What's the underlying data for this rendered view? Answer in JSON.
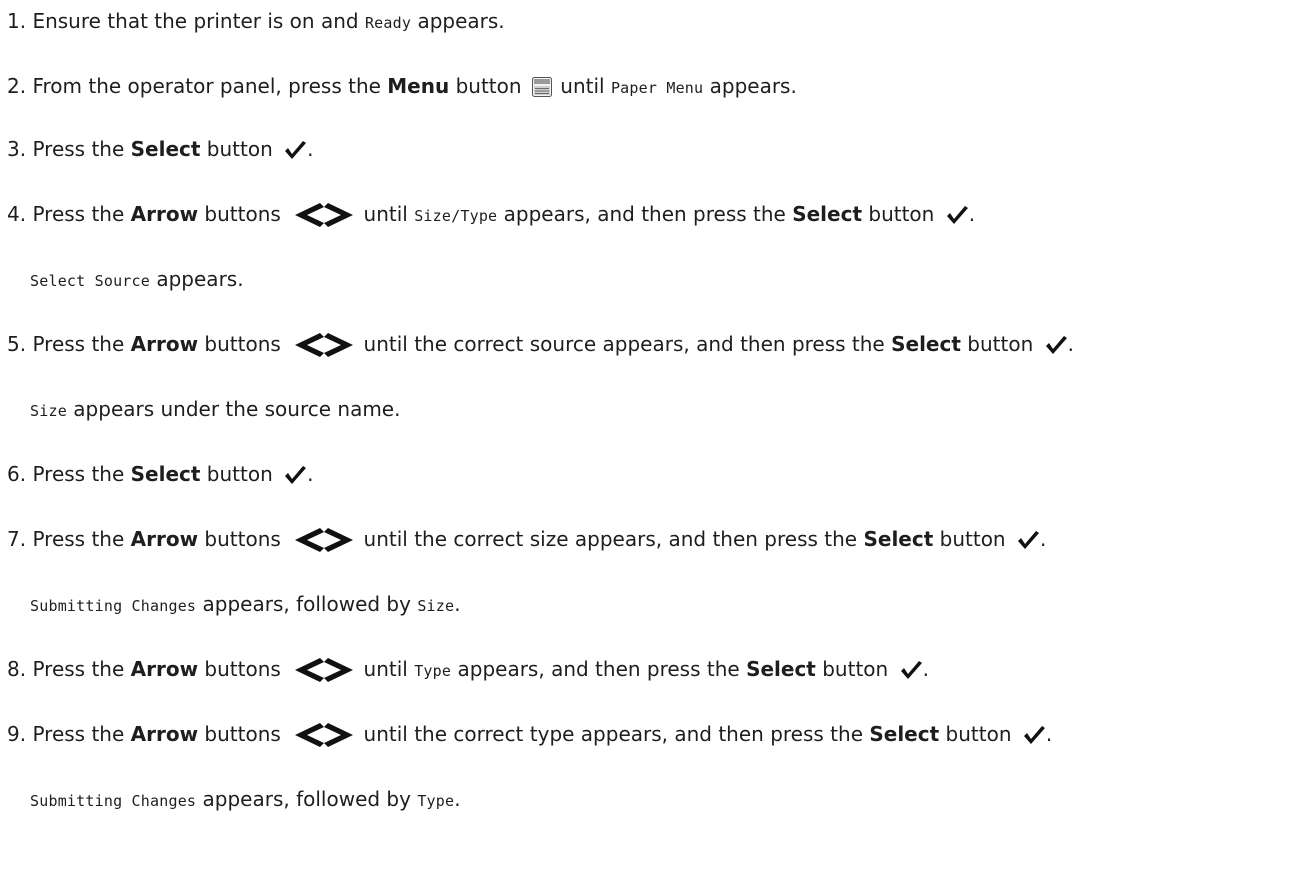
{
  "icons": {
    "menu": "menu-icon",
    "select": "check-icon",
    "arrows": "left-right-arrows-icon"
  },
  "colors": {
    "text": "#1e1e1e",
    "icon": "#111111",
    "menu_icon_frame": "#555555",
    "menu_icon_fill": "#9a9a9a"
  },
  "steps": {
    "s1": {
      "num": "1.",
      "a": "Ensure that the printer is on and ",
      "code": "Ready",
      "b": " appears."
    },
    "s2": {
      "num": "2.",
      "a": "From the operator panel, press the ",
      "bold": "Menu",
      "b": " button ",
      "c": " until ",
      "code": "Paper Menu",
      "d": " appears."
    },
    "s3": {
      "num": "3.",
      "a": "Press the ",
      "bold": "Select",
      "b": " button ",
      "c": "."
    },
    "s4": {
      "num": "4.",
      "a": "Press the ",
      "bold1": "Arrow",
      "b": " buttons ",
      "c": " until ",
      "code": "Size/Type",
      "d": " appears, and then press the ",
      "bold2": "Select",
      "e": " button ",
      "f": "."
    },
    "n4": {
      "code": "Select Source",
      "a": " appears."
    },
    "s5": {
      "num": "5.",
      "a": "Press the ",
      "bold1": "Arrow",
      "b": " buttons ",
      "c": " until the correct source appears, and then press the ",
      "bold2": "Select",
      "d": " button ",
      "e": "."
    },
    "n5": {
      "code": "Size",
      "a": " appears under the source name."
    },
    "s6": {
      "num": "6.",
      "a": "Press the ",
      "bold": "Select",
      "b": " button ",
      "c": "."
    },
    "s7": {
      "num": "7.",
      "a": "Press the ",
      "bold1": "Arrow",
      "b": " buttons ",
      "c": " until the correct size appears, and then press the ",
      "bold2": "Select",
      "d": " button ",
      "e": "."
    },
    "n7": {
      "code1": "Submitting Changes",
      "a": " appears, followed by ",
      "code2": "Size",
      "b": "."
    },
    "s8": {
      "num": "8.",
      "a": "Press the ",
      "bold1": "Arrow",
      "b": " buttons ",
      "c": " until ",
      "code": "Type",
      "d": " appears, and then press the ",
      "bold2": "Select",
      "e": " button ",
      "f": "."
    },
    "s9": {
      "num": "9.",
      "a": "Press the ",
      "bold1": "Arrow",
      "b": " buttons ",
      "c": " until the correct type appears, and then press the ",
      "bold2": "Select",
      "d": " button ",
      "e": "."
    },
    "n9": {
      "code1": "Submitting Changes",
      "a": " appears, followed by ",
      "code2": "Type",
      "b": "."
    }
  }
}
